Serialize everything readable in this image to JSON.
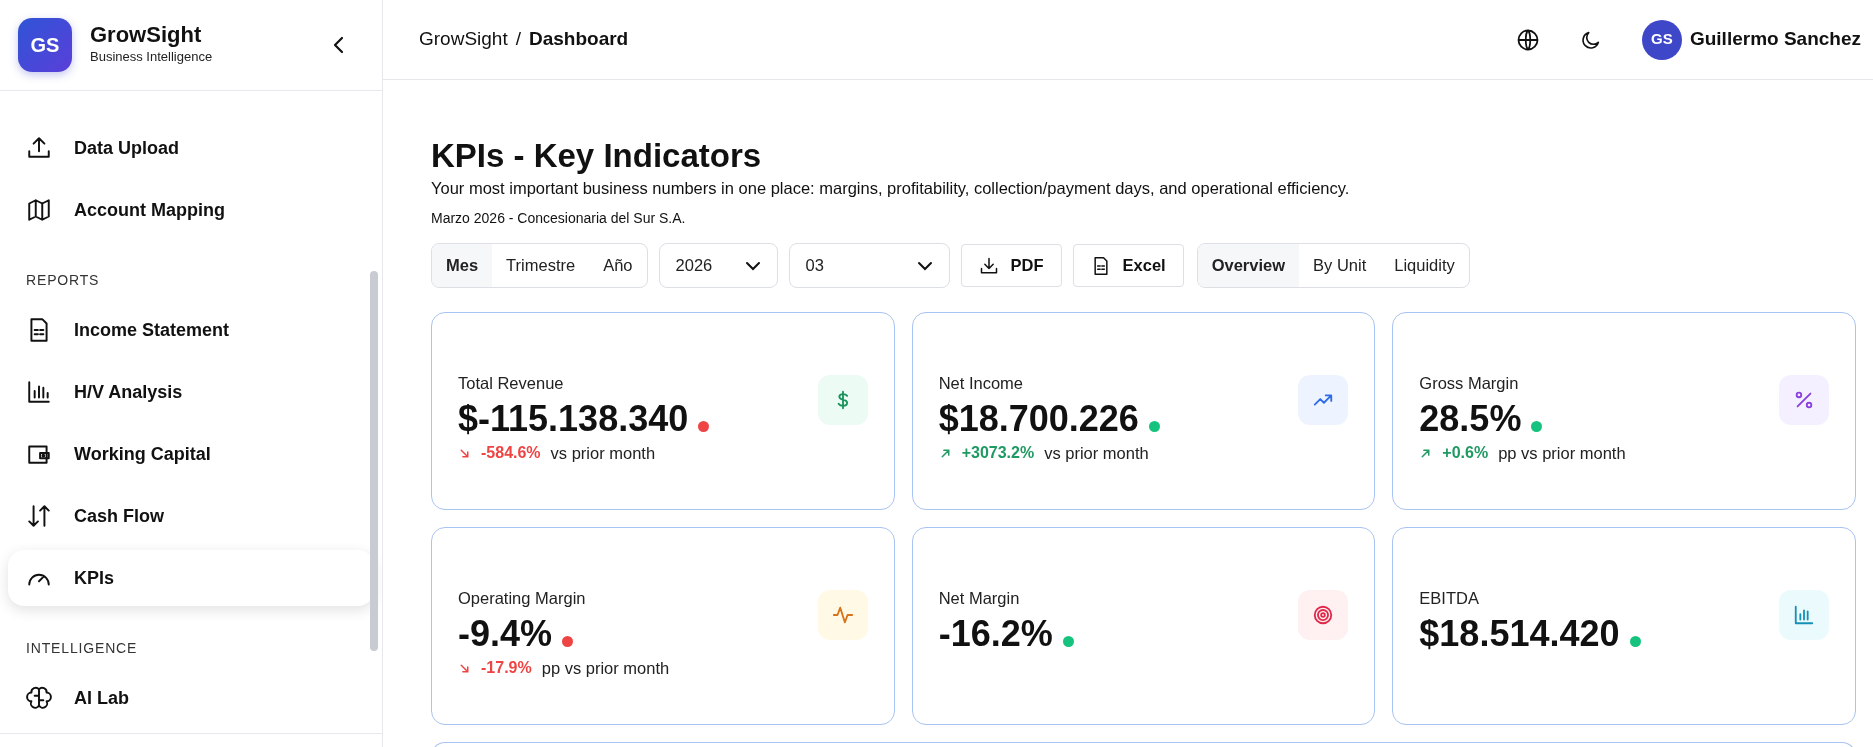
{
  "brand": {
    "logo": "GS",
    "name": "GrowSight",
    "tagline": "Business Intelligence"
  },
  "sidebar": {
    "items": [
      {
        "kind": "item",
        "label": "Data Upload",
        "selected": false
      },
      {
        "kind": "item",
        "label": "Account Mapping",
        "selected": false
      },
      {
        "kind": "section",
        "label": "REPORTS"
      },
      {
        "kind": "item",
        "label": "Income Statement",
        "selected": false
      },
      {
        "kind": "item",
        "label": "H/V Analysis",
        "selected": false
      },
      {
        "kind": "item",
        "label": "Working Capital",
        "selected": false
      },
      {
        "kind": "item",
        "label": "Cash Flow",
        "selected": false
      },
      {
        "kind": "item",
        "label": "KPIs",
        "selected": true
      },
      {
        "kind": "section",
        "label": "INTELLIGENCE"
      },
      {
        "kind": "item",
        "label": "AI Lab",
        "selected": false
      }
    ]
  },
  "breadcrumb": [
    "GrowSight",
    "/",
    "Dashboard"
  ],
  "user": {
    "initials": "GS",
    "name": "Guillermo Sanchez"
  },
  "page": {
    "title": "KPIs - Key Indicators",
    "subtitle": "Your most important business numbers in one place: margins, profitability, collection/payment days, and operational efficiency.",
    "context": "Marzo 2026 - Concesionaria del Sur S.A."
  },
  "periods": [
    {
      "label": "Mes",
      "selected": true
    },
    {
      "label": "Trimestre",
      "selected": false
    },
    {
      "label": "Año",
      "selected": false
    }
  ],
  "year_select": {
    "value": "2026"
  },
  "month_select": {
    "value": "03"
  },
  "exports": [
    "PDF",
    "Excel"
  ],
  "views": [
    {
      "label": "Overview",
      "selected": true
    },
    {
      "label": "By Unit",
      "selected": false
    },
    {
      "label": "Liquidity",
      "selected": false
    }
  ],
  "cards": [
    {
      "label": "Total Revenue",
      "value": "$-115.138.340",
      "positive": false,
      "change": {
        "rising": false,
        "value": "-584.6%",
        "text": "vs prior month"
      }
    },
    {
      "label": "Net Income",
      "value": "$18.700.226",
      "positive": true,
      "change": {
        "rising": true,
        "value": "+3073.2%",
        "text": "vs prior month"
      }
    },
    {
      "label": "Gross Margin",
      "value": "28.5%",
      "positive": true,
      "change": {
        "rising": true,
        "value": "+0.6%",
        "text": "pp vs prior month"
      }
    },
    {
      "label": "Operating Margin",
      "value": "-9.4%",
      "positive": false,
      "change": {
        "rising": false,
        "value": "-17.9%",
        "text": "pp vs prior month"
      }
    },
    {
      "label": "Net Margin",
      "value": "-16.2%",
      "positive": true
    },
    {
      "label": "EBITDA",
      "value": "$18.514.420",
      "positive": true
    }
  ]
}
